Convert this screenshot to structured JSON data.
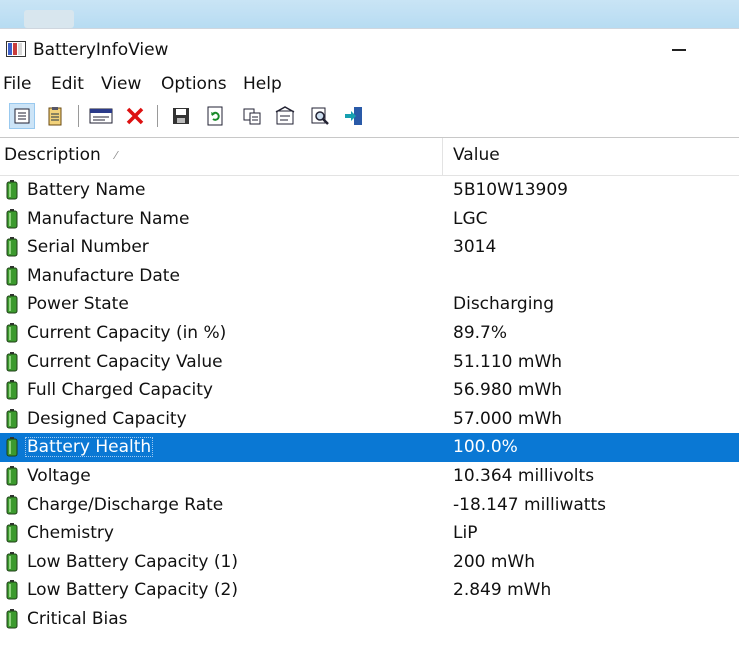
{
  "window": {
    "title": "BatteryInfoView"
  },
  "menu": [
    "File",
    "Edit",
    "View",
    "Options",
    "Help"
  ],
  "toolbar": {
    "icons": [
      "properties-view-icon",
      "clipboard-view-icon",
      "html-report-icon",
      "delete-icon",
      "save-icon",
      "refresh-icon",
      "copy-icon",
      "properties-icon",
      "find-icon",
      "exit-icon"
    ]
  },
  "columns": {
    "description": "Description",
    "sort_indicator": "⁄",
    "value": "Value"
  },
  "rows": [
    {
      "desc": "Battery Name",
      "value": "5B10W13909"
    },
    {
      "desc": "Manufacture Name",
      "value": "LGC"
    },
    {
      "desc": "Serial Number",
      "value": " 3014"
    },
    {
      "desc": "Manufacture Date",
      "value": ""
    },
    {
      "desc": "Power State",
      "value": "Discharging"
    },
    {
      "desc": "Current Capacity (in %)",
      "value": "89.7%"
    },
    {
      "desc": "Current Capacity Value",
      "value": "51.110 mWh"
    },
    {
      "desc": "Full Charged Capacity",
      "value": "56.980 mWh"
    },
    {
      "desc": "Designed Capacity",
      "value": "57.000 mWh"
    },
    {
      "desc": "Battery Health",
      "value": "100.0%",
      "selected": true
    },
    {
      "desc": "Voltage",
      "value": "10.364 millivolts"
    },
    {
      "desc": "Charge/Discharge Rate",
      "value": "-18.147 milliwatts"
    },
    {
      "desc": "Chemistry",
      "value": "LiP"
    },
    {
      "desc": "Low Battery Capacity (1)",
      "value": "200 mWh"
    },
    {
      "desc": "Low Battery Capacity (2)",
      "value": "2.849 mWh"
    },
    {
      "desc": "Critical Bias",
      "value": ""
    }
  ],
  "colors": {
    "selection": "#0a78d4",
    "battery_green": "#3c9a2e"
  }
}
